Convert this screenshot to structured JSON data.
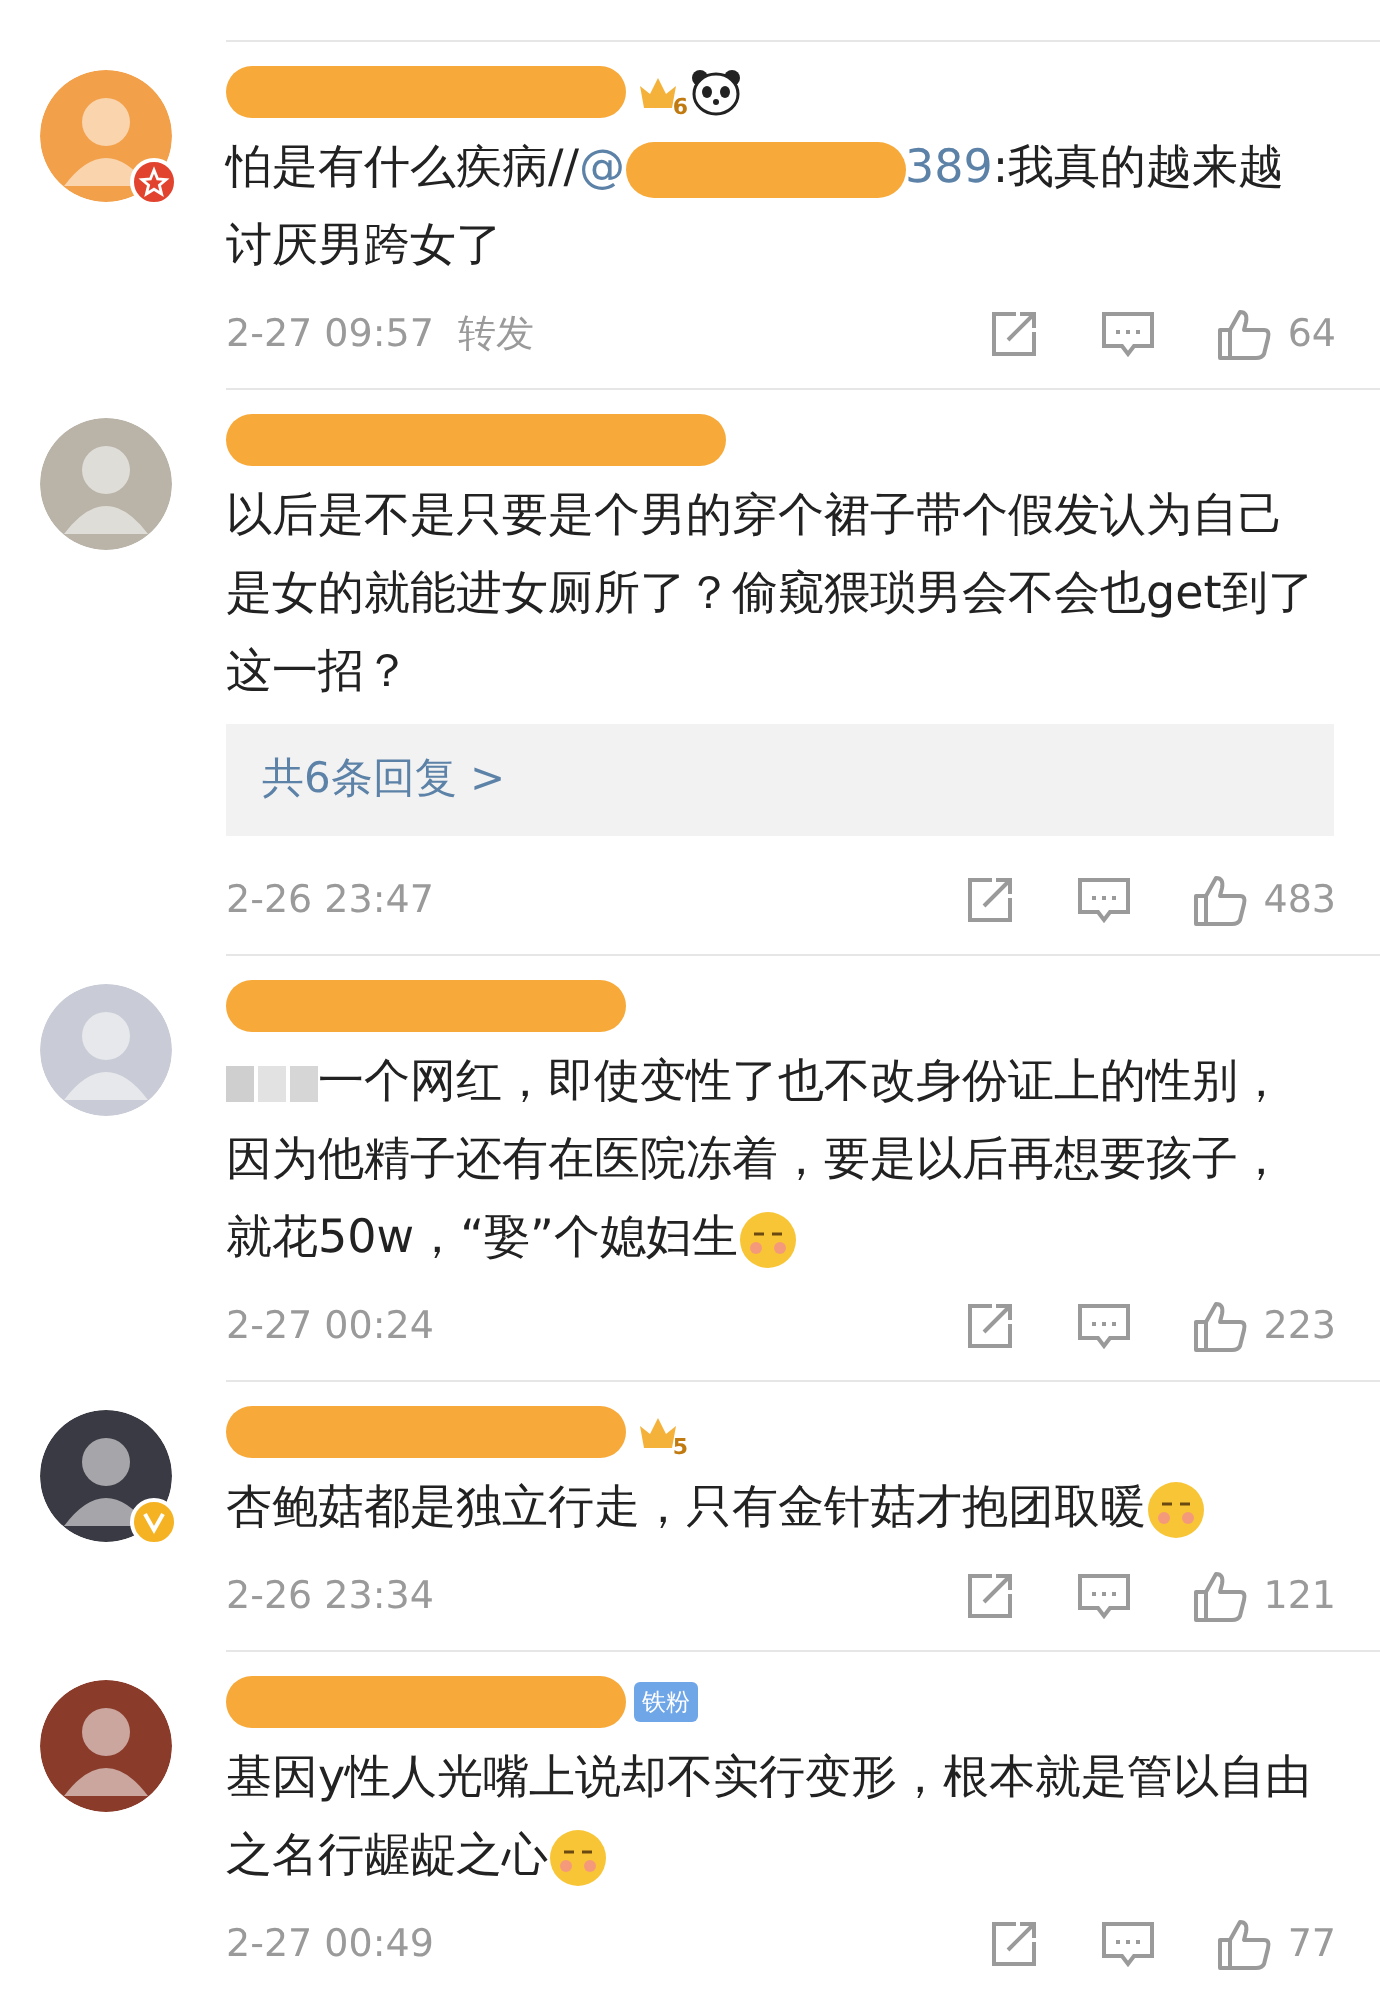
{
  "comments": [
    {
      "name_hidden": true,
      "avatar_badge": {
        "kind": "star"
      },
      "name_badges": [
        {
          "kind": "level",
          "text": "6"
        },
        {
          "kind": "panda"
        }
      ],
      "segments": [
        {
          "kind": "text",
          "text": "怕是有什么疾病//"
        },
        {
          "kind": "mention",
          "text": "@"
        },
        {
          "kind": "redacted"
        },
        {
          "kind": "mention",
          "text": "389"
        },
        {
          "kind": "text",
          "text": ":我真的越来越讨厌男跨女了"
        }
      ],
      "time": "2-27 09:57",
      "forward_label": "转发",
      "likes": "64"
    },
    {
      "name_hidden": true,
      "segments": [
        {
          "kind": "text",
          "text": "以后是不是只要是个男的穿个裙子带个假发认为自己是女的就能进女厕所了？偷窥猥琐男会不会也get到了这一招？"
        }
      ],
      "reply_link": "共6条回复 >",
      "time": "2-26 23:47",
      "likes": "483"
    },
    {
      "name_hidden": true,
      "segments": [
        {
          "kind": "blurred"
        },
        {
          "kind": "text",
          "text": "一个网红，即使变性了也不改身份证上的性别，因为他精子还有在医院冻着，要是以后再想要孩子，就花50w，“娶”个媳妇生"
        },
        {
          "kind": "emoji"
        }
      ],
      "time": "2-27 00:24",
      "likes": "223"
    },
    {
      "name_hidden": true,
      "avatar_badge": {
        "kind": "v"
      },
      "name_badges": [
        {
          "kind": "level",
          "text": "5"
        }
      ],
      "segments": [
        {
          "kind": "text",
          "text": "杏鲍菇都是独立行走，只有金针菇才抱团取暖"
        },
        {
          "kind": "emoji"
        }
      ],
      "time": "2-26 23:34",
      "likes": "121"
    },
    {
      "name_hidden": true,
      "name_badges": [
        {
          "kind": "fan",
          "text": "铁粉"
        }
      ],
      "segments": [
        {
          "kind": "text",
          "text": "基因y性人光嘴上说却不实行变形，根本就是管以自由之名行龌龊之心"
        },
        {
          "kind": "emoji"
        }
      ],
      "time": "2-27 00:49",
      "likes": "77"
    }
  ]
}
